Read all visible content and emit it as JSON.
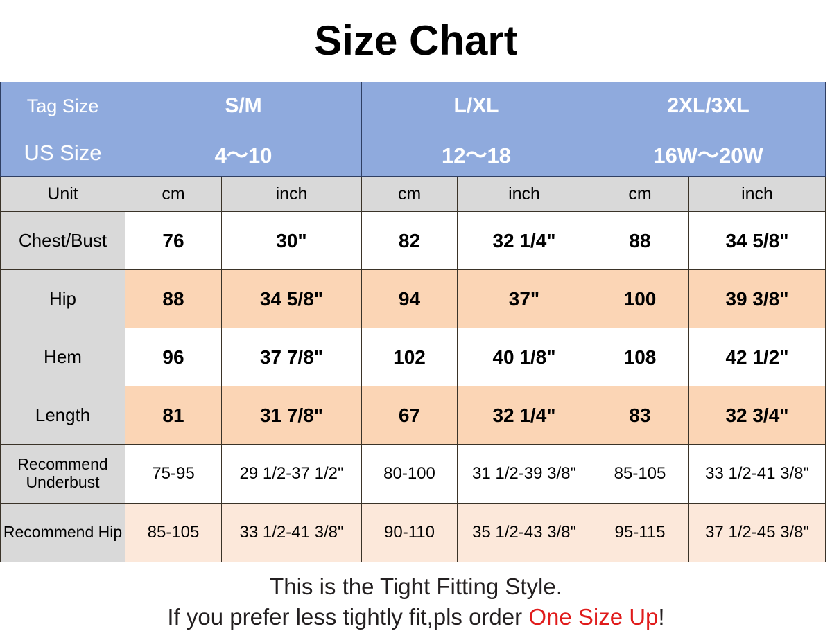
{
  "title": "Size Chart",
  "colors": {
    "header_blue": "#8FAADD",
    "unit_gray": "#D9D9D9",
    "highlight_orange": "#FBD5B5",
    "highlight_orange_light": "#FCE8DA",
    "emphasis_red": "#E01B1B",
    "border": "#3A3328"
  },
  "table": {
    "row_labels": {
      "tag_size": "Tag Size",
      "us_size": "US Size",
      "unit": "Unit"
    },
    "size_groups": [
      {
        "tag_size": "S/M",
        "us_size": "4〜10"
      },
      {
        "tag_size": "L/XL",
        "us_size": "12〜18"
      },
      {
        "tag_size": "2XL/3XL",
        "us_size": "16W〜20W"
      }
    ],
    "unit_headers": [
      "cm",
      "inch",
      "cm",
      "inch",
      "cm",
      "inch"
    ],
    "rows": [
      {
        "label": "Chest/Bust",
        "values": [
          "76",
          "30\"",
          "82",
          "32 1/4\"",
          "88",
          "34 5/8\""
        ]
      },
      {
        "label": "Hip",
        "values": [
          "88",
          "34 5/8\"",
          "94",
          "37\"",
          "100",
          "39 3/8\""
        ]
      },
      {
        "label": "Hem",
        "values": [
          "96",
          "37 7/8\"",
          "102",
          "40 1/8\"",
          "108",
          "42 1/2\""
        ]
      },
      {
        "label": "Length",
        "values": [
          "81",
          "31 7/8\"",
          "67",
          "32 1/4\"",
          "83",
          "32 3/4\""
        ]
      },
      {
        "label": "Recommend Underbust",
        "values": [
          "75-95",
          "29 1/2-37 1/2\"",
          "80-100",
          "31 1/2-39 3/8\"",
          "85-105",
          "33 1/2-41 3/8\""
        ]
      },
      {
        "label": "Recommend Hip",
        "values": [
          "85-105",
          "33 1/2-41 3/8\"",
          "90-110",
          "35 1/2-43 3/8\"",
          "95-115",
          "37 1/2-45 3/8\""
        ]
      }
    ]
  },
  "footer": {
    "line1": "This is the Tight Fitting Style.",
    "line2_prefix": "If you prefer less tightly fit,pls order ",
    "line2_emphasis": "One Size Up",
    "line2_suffix": "!"
  }
}
